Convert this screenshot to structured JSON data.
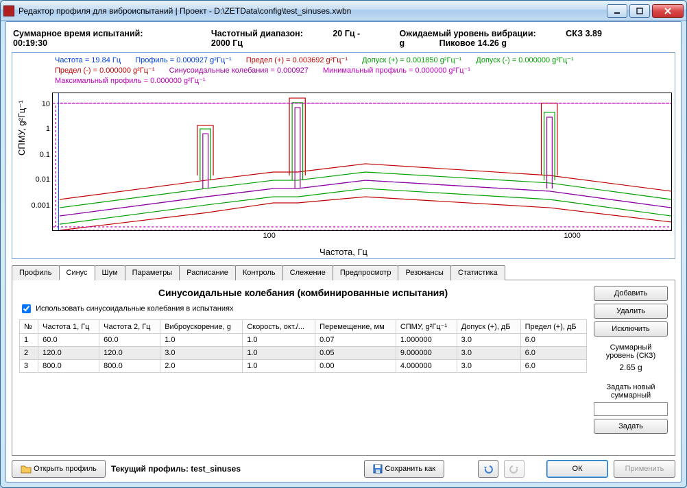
{
  "window": {
    "title": "Редактор профиля для виброиспытаний | Проект - D:\\ZETData\\config\\test_sinuses.xwbn"
  },
  "summary": {
    "total_time_label": "Суммарное время испытаний:",
    "total_time_value": "00:19:30",
    "freq_range_label": "Частотный диапазон:",
    "freq_range_value": "20 Гц - 2000 Гц",
    "expected_label": "Ожидаемый уровень вибрации:",
    "expected_rms": "СКЗ 3.89 g",
    "expected_peak": "Пиковое 14.26 g"
  },
  "legend": {
    "freq": "Частота = 19.84 Гц",
    "profile": "Профиль = 0.000927 g²Гц⁻¹",
    "lim_p": "Предел (+) = 0.003692 g²Гц⁻¹",
    "tol_p": "Допуск (+) = 0.001850 g²Гц⁻¹",
    "tol_m": "Допуск (-) = 0.000000 g²Гц⁻¹",
    "lim_m": "Предел (-) = 0.000000 g²Гц⁻¹",
    "sine": "Синусоидальные колебания = 0.000927",
    "min_p": "Минимальный профиль = 0.000000 g²Гц⁻¹",
    "max_p": "Максимальный профиль = 0.000000 g²Гц⁻¹"
  },
  "chart": {
    "ylabel": "СПМУ, g²Гц⁻¹",
    "xlabel": "Частота, Гц"
  },
  "chart_data": {
    "type": "line",
    "xscale": "log",
    "yscale": "log",
    "xlim": [
      19,
      2000
    ],
    "ylim": [
      0.0003,
      30
    ],
    "xticks": [
      100,
      1000
    ],
    "yticks": [
      0.001,
      0.01,
      0.1,
      1,
      10
    ],
    "xlabel": "Частота, Гц",
    "ylabel": "СПМУ, g²Гц⁻¹",
    "series": [
      {
        "name": "Профиль",
        "color": "#0040e0",
        "x": [
          20,
          60,
          100,
          120,
          200,
          800,
          2000
        ],
        "y": [
          0.001,
          0.005,
          0.01,
          0.01,
          0.02,
          0.008,
          0.002
        ]
      },
      {
        "name": "Предел (+)",
        "color": "#c00000",
        "x": [
          20,
          60,
          100,
          120,
          200,
          800,
          2000
        ],
        "y": [
          0.004,
          0.02,
          0.04,
          0.04,
          0.08,
          0.03,
          0.008
        ]
      },
      {
        "name": "Предел (-)",
        "color": "#c00000",
        "x": [
          20,
          60,
          100,
          120,
          200,
          800,
          2000
        ],
        "y": [
          0.0003,
          0.0013,
          0.003,
          0.003,
          0.005,
          0.002,
          0.0006
        ]
      },
      {
        "name": "Допуск (+)",
        "color": "#00a000",
        "x": [
          20,
          60,
          100,
          120,
          200,
          800,
          2000
        ],
        "y": [
          0.002,
          0.01,
          0.02,
          0.02,
          0.04,
          0.016,
          0.004
        ]
      },
      {
        "name": "Допуск (-)",
        "color": "#00a000",
        "x": [
          20,
          60,
          100,
          120,
          200,
          800,
          2000
        ],
        "y": [
          0.0005,
          0.0025,
          0.005,
          0.005,
          0.01,
          0.004,
          0.001
        ]
      },
      {
        "name": "Синусоидальные колебания",
        "color": "#a000a0",
        "x": [
          20,
          60,
          100,
          120,
          200,
          800,
          2000
        ],
        "y": [
          0.001,
          0.005,
          0.01,
          0.01,
          0.02,
          0.008,
          0.002
        ]
      },
      {
        "name": "Минимальный профиль",
        "color": "#c000c0",
        "style": "dotted",
        "x": [
          20,
          2000
        ],
        "y": [
          0.0003,
          0.0003
        ]
      },
      {
        "name": "Максимальный профиль",
        "color": "#c000c0",
        "style": "dotted",
        "x": [
          20,
          2000
        ],
        "y": [
          13,
          13
        ]
      }
    ],
    "sine_peaks": [
      {
        "freq": 60,
        "spmu": 1.0,
        "limit_plus": 2.0,
        "limit_minus": 0.0003
      },
      {
        "freq": 120,
        "spmu": 9.0,
        "limit_plus": 20,
        "limit_minus": 0.0003
      },
      {
        "freq": 800,
        "spmu": 4.0,
        "limit_plus": 13,
        "limit_minus": 0.0003
      }
    ]
  },
  "tabs": {
    "items": [
      "Профиль",
      "Синус",
      "Шум",
      "Параметры",
      "Расписание",
      "Контроль",
      "Слежение",
      "Предпросмотр",
      "Резонансы",
      "Статистика"
    ],
    "active": 1
  },
  "sine": {
    "heading": "Синусоидальные колебания (комбинированные испытания)",
    "use_checkbox_label": "Использовать синусоидальные колебания в испытаниях",
    "use_checkbox_checked": true,
    "columns": [
      "№",
      "Частота 1, Гц",
      "Частота 2, Гц",
      "Виброускорение, g",
      "Скорость, окт./...",
      "Перемещение, мм",
      "СПМУ, g²Гц⁻¹",
      "Допуск (+), дБ",
      "Предел (+), дБ"
    ],
    "rows": [
      {
        "n": "1",
        "f1": "60.0",
        "f2": "60.0",
        "acc": "1.0",
        "rate": "1.0",
        "disp": "0.07",
        "spmu": "1.000000",
        "tol": "3.0",
        "lim": "6.0"
      },
      {
        "n": "2",
        "f1": "120.0",
        "f2": "120.0",
        "acc": "3.0",
        "rate": "1.0",
        "disp": "0.05",
        "spmu": "9.000000",
        "tol": "3.0",
        "lim": "6.0"
      },
      {
        "n": "3",
        "f1": "800.0",
        "f2": "800.0",
        "acc": "2.0",
        "rate": "1.0",
        "disp": "0.00",
        "spmu": "4.000000",
        "tol": "3.0",
        "lim": "6.0"
      }
    ],
    "selected_row": 1
  },
  "side": {
    "add": "Добавить",
    "remove": "Удалить",
    "exclude": "Исключить",
    "sum_label1": "Суммарный",
    "sum_label2": "уровень (СКЗ)",
    "sum_value": "2.65 g",
    "set_label1": "Задать новый",
    "set_label2": "суммарный",
    "set_button": "Задать"
  },
  "bottom": {
    "open": "Открыть профиль",
    "current_label": "Текущий профиль:",
    "current_value": "test_sinuses",
    "save_as": "Сохранить как",
    "ok": "ОК",
    "apply": "Применить"
  }
}
